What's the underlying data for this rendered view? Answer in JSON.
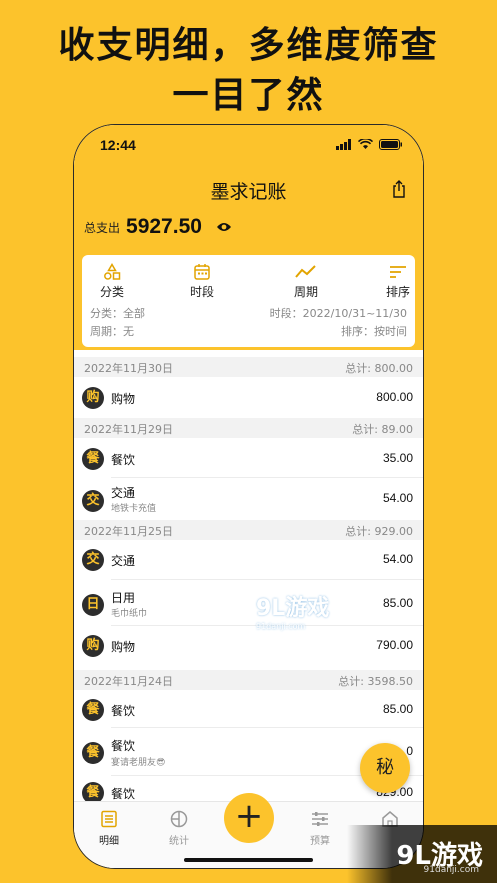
{
  "headline": {
    "line1": "收支明细，多维度筛查",
    "line2": "一目了然"
  },
  "status": {
    "time": "12:44"
  },
  "app": {
    "title": "墨求记账"
  },
  "total": {
    "label": "总支出",
    "amount": "5927.50"
  },
  "filters": {
    "tabs": [
      {
        "label": "分类"
      },
      {
        "label": "时段"
      },
      {
        "label": "周期"
      },
      {
        "label": "排序"
      }
    ],
    "category": "分类：全部",
    "period": "时段：2022/10/31~11/30",
    "cycle": "周期：无",
    "sort": "排序：按时间"
  },
  "groups": [
    {
      "date": "2022年11月30日",
      "total": "总计: 800.00",
      "items": [
        {
          "icon": "购",
          "name": "购物",
          "note": "",
          "amount": "800.00"
        }
      ]
    },
    {
      "date": "2022年11月29日",
      "total": "总计: 89.00",
      "items": [
        {
          "icon": "餐",
          "name": "餐饮",
          "note": "",
          "amount": "35.00"
        },
        {
          "icon": "交",
          "name": "交通",
          "note": "地铁卡充值",
          "amount": "54.00"
        }
      ]
    },
    {
      "date": "2022年11月25日",
      "total": "总计: 929.00",
      "items": [
        {
          "icon": "交",
          "name": "交通",
          "note": "",
          "amount": "54.00"
        },
        {
          "icon": "日",
          "name": "日用",
          "note": "毛巾纸巾",
          "amount": "85.00"
        },
        {
          "icon": "购",
          "name": "购物",
          "note": "",
          "amount": "790.00"
        }
      ]
    },
    {
      "date": "2022年11月24日",
      "total": "总计: 3598.50",
      "items": [
        {
          "icon": "餐",
          "name": "餐饮",
          "note": "",
          "amount": "85.00"
        },
        {
          "icon": "餐",
          "name": "餐饮",
          "note": "宴请老朋友😎",
          "amount": "0"
        },
        {
          "icon": "餐",
          "name": "餐饮",
          "note": "",
          "amount": "829.00"
        }
      ]
    }
  ],
  "fab": {
    "label": "秘"
  },
  "tabbar": {
    "tabs": [
      {
        "label": "明细"
      },
      {
        "label": "统计"
      },
      {
        "label": "预算"
      },
      {
        "label": ""
      }
    ],
    "add": "+"
  },
  "watermark": {
    "center": "9L游戏",
    "center_sub": "91danji.com",
    "corner": "9L游戏",
    "corner_sub": "91danji.com"
  }
}
